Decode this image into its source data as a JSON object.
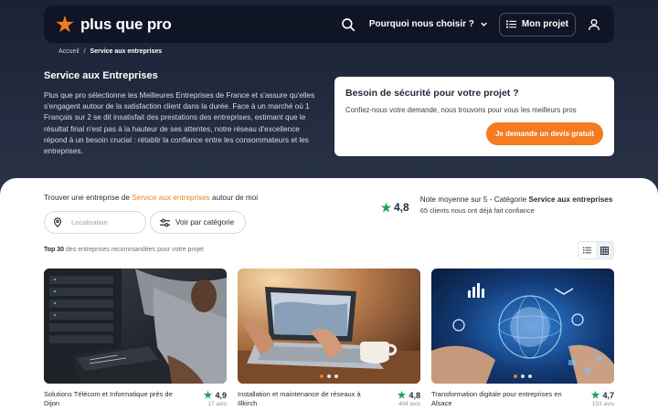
{
  "nav": {
    "brand": "plus que pro",
    "why_label": "Pourquoi nous choisir ?",
    "project_label": "Mon projet"
  },
  "breadcrumb": {
    "home": "Accueil",
    "sep": "/",
    "current": "Service aux entreprises"
  },
  "hero": {
    "title": "Service aux Entreprises",
    "text": "Plus que pro sélectionne les Meilleures Entreprises de France et s'assure qu'elles s'engagent autour de la satisfaction client dans la durée. Face à un marché où 1 Français sur 2 se dit insatisfait des prestations des entreprises, estimant que le résultat final n'est pas à la hauteur de ses attentes, notre réseau d'excellence répond à un besoin crucial : rétablir la confiance entre les consommateurs et les entreprises."
  },
  "cta": {
    "title": "Besoin de sécurité pour votre projet ?",
    "subtitle": "Confiez-nous votre demande, nous trouvons pour vous les meilleurs pros",
    "button": "Je demande un devis gratuit"
  },
  "search": {
    "intro_prefix": "Trouver une entreprise de ",
    "intro_category": "Service aux entreprises",
    "intro_suffix": " autour de moi",
    "location_placeholder": "Localisation",
    "category_button": "Voir par catégorie"
  },
  "rating": {
    "score": "4,8",
    "line1_prefix": "Note moyenne sur 5 - Catégorie ",
    "line1_category": "Service aux entreprises",
    "line2": "65 clients nous ont déjà fait confiance"
  },
  "listing": {
    "top_bold": "Top 30",
    "top_rest": " des entreprises recommandées pour votre projet"
  },
  "cards": [
    {
      "title": "Solutions Télécom et Informatique près de Dijon",
      "rating": "4,9",
      "reviews": "17 avis"
    },
    {
      "title": "Installation et maintenance de réseaux à Illkirch",
      "rating": "4,8",
      "reviews": "404 avis"
    },
    {
      "title": "Transformation digitale pour entreprises en Alsace",
      "rating": "4,7",
      "reviews": "153 avis"
    }
  ],
  "colors": {
    "accent": "#f47b1f",
    "rating_green": "#1aa35a",
    "dark": "#0f1524"
  }
}
